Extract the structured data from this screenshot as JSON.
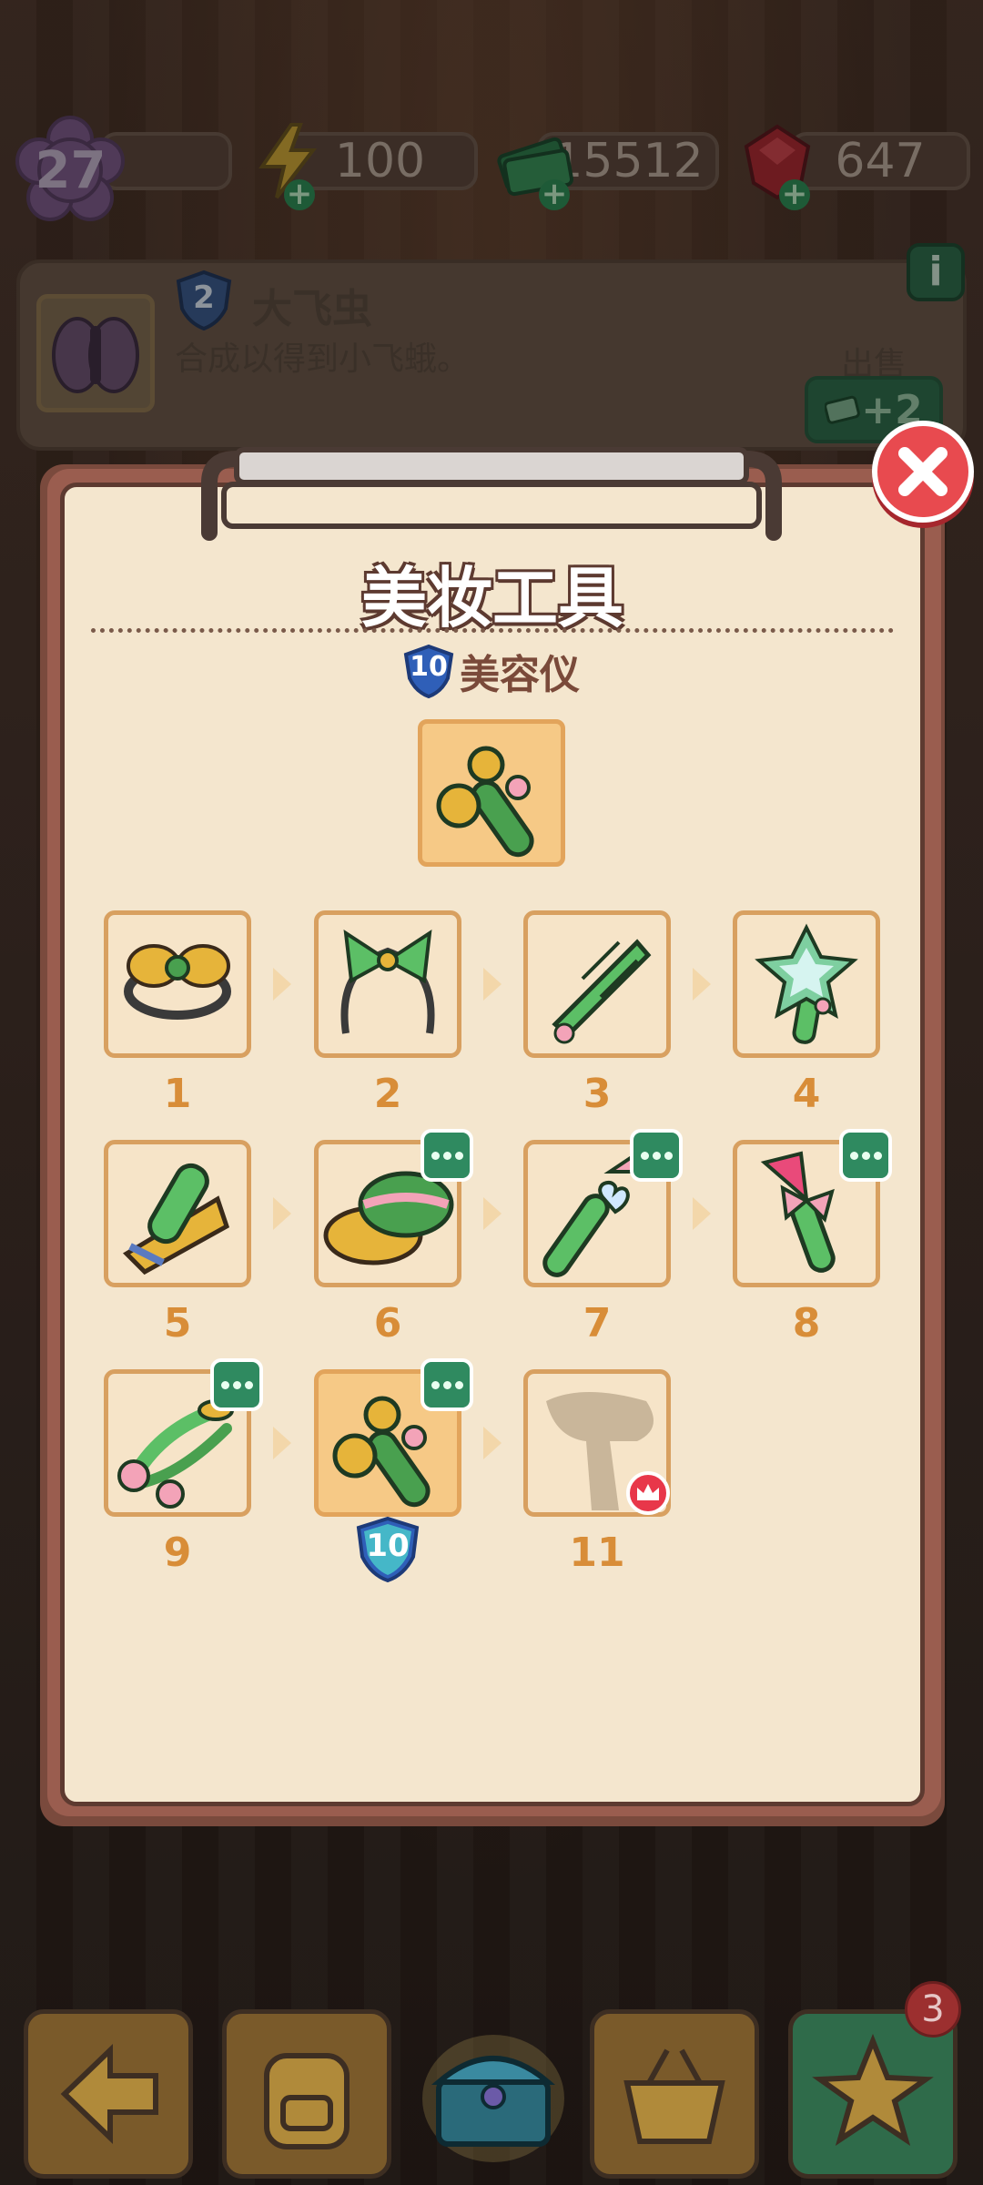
{
  "hud": {
    "level": "27",
    "energy": "100",
    "cash": "15512",
    "gems": "647"
  },
  "info": {
    "item_level": "2",
    "item_name": "大飞虫",
    "item_desc": "合成以得到小飞蛾。",
    "sell_label": "出售",
    "sell_value": "+2",
    "info_button": "i"
  },
  "panel": {
    "title": "美妆工具",
    "selected_level": "10",
    "selected_name": "美容仪",
    "items": [
      {
        "num": "1",
        "icon": "hair-clip-icon"
      },
      {
        "num": "2",
        "icon": "bow-headband-icon"
      },
      {
        "num": "3",
        "icon": "comb-icon"
      },
      {
        "num": "4",
        "icon": "star-mirror-icon"
      },
      {
        "num": "5",
        "icon": "hair-straightener-icon"
      },
      {
        "num": "6",
        "icon": "makeup-compact-icon"
      },
      {
        "num": "7",
        "icon": "heart-brush-icon"
      },
      {
        "num": "8",
        "icon": "bow-brush-icon"
      },
      {
        "num": "9",
        "icon": "eyelash-curler-icon"
      },
      {
        "num": "10",
        "icon": "facial-roller-icon"
      },
      {
        "num": "11",
        "icon": "hair-dryer-silhouette-icon"
      }
    ],
    "current_badge": "10"
  },
  "bottom": {
    "notification_count": "3"
  },
  "colors": {
    "panel_bg": "#f4e6ce",
    "item_border": "#d8a060",
    "accent_green": "#2f8a60",
    "close_red": "#e84a4f",
    "number_orange": "#d88d38"
  }
}
